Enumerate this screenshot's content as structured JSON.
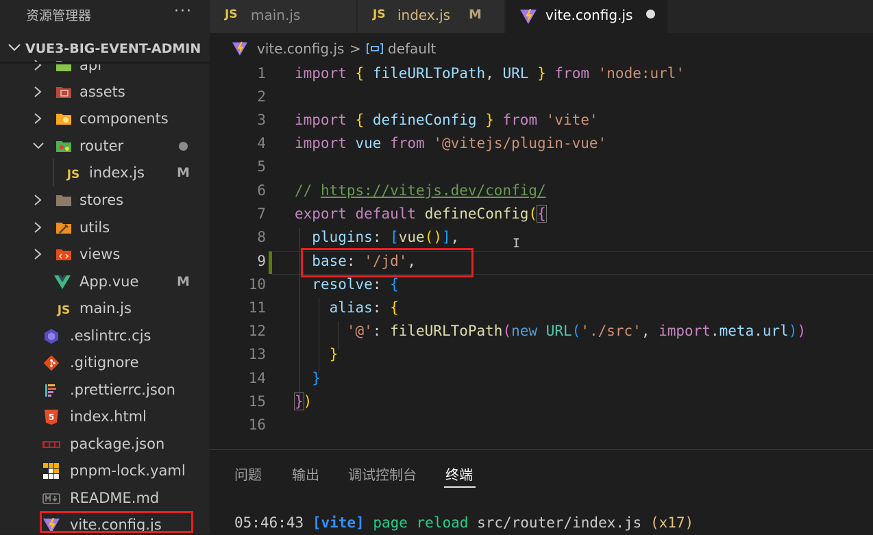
{
  "sidebar": {
    "title": "资源管理器",
    "more": "···",
    "project": "VUE3-BIG-EVENT-ADMIN",
    "items": [
      {
        "label": "api",
        "type": "folder"
      },
      {
        "label": "assets",
        "type": "folder"
      },
      {
        "label": "components",
        "type": "folder"
      },
      {
        "label": "router",
        "type": "folder-open"
      },
      {
        "label": "index.js",
        "type": "js",
        "badge": "M"
      },
      {
        "label": "stores",
        "type": "folder"
      },
      {
        "label": "utils",
        "type": "folder"
      },
      {
        "label": "views",
        "type": "folder"
      },
      {
        "label": "App.vue",
        "type": "vue",
        "badge": "M"
      },
      {
        "label": "main.js",
        "type": "js"
      },
      {
        "label": ".eslintrc.cjs",
        "type": "eslint"
      },
      {
        "label": ".gitignore",
        "type": "git"
      },
      {
        "label": ".prettierrc.json",
        "type": "prettier"
      },
      {
        "label": "index.html",
        "type": "html"
      },
      {
        "label": "package.json",
        "type": "npm"
      },
      {
        "label": "pnpm-lock.yaml",
        "type": "pnpm"
      },
      {
        "label": "README.md",
        "type": "md"
      },
      {
        "label": "vite.config.js",
        "type": "vite"
      }
    ]
  },
  "tabs": [
    {
      "label": "main.js",
      "icon": "JS"
    },
    {
      "label": "index.js",
      "icon": "JS",
      "badge": "M"
    },
    {
      "label": "vite.config.js",
      "icon": "vite",
      "active": true
    }
  ],
  "breadcrumb": {
    "file": "vite.config.js",
    "sep": ">",
    "symbol": "default"
  },
  "editor": {
    "line_numbers": [
      "1",
      "2",
      "3",
      "4",
      "5",
      "6",
      "7",
      "8",
      "9",
      "10",
      "11",
      "12",
      "13",
      "14",
      "15",
      "16"
    ],
    "tokens": {
      "import": "import",
      "from": "from",
      "export": "export",
      "default": "default",
      "new": "new",
      "fileURLToPath": "fileURLToPath",
      "URL": "URL",
      "defineConfig": "defineConfig",
      "vue": "vue",
      "plugins": "plugins",
      "base": "base",
      "resolve": "resolve",
      "alias": "alias",
      "meta": "meta",
      "url": "url",
      "node_url": "'node:url'",
      "vite": "'vite'",
      "plugin_vue": "'@vitejs/plugin-vue'",
      "comment_prefix": "// ",
      "comment_url": "https://vitejs.dev/config/",
      "base_value": "'/jd'",
      "at": "'@'",
      "src": "'./src'"
    }
  },
  "panel": {
    "tabs": [
      "问题",
      "输出",
      "调试控制台",
      "终端"
    ],
    "active_tab": "终端",
    "terminal": {
      "time": "05:46:43",
      "tag": "[vite]",
      "message": "page reload",
      "path": "src/router/index.js",
      "count": "(x17)"
    }
  },
  "colors": {
    "highlight_box": "#e81f1f",
    "js_icon": "#e3c24a",
    "vite_purple": "#9f7aea",
    "vite_yellow": "#ffc517"
  }
}
